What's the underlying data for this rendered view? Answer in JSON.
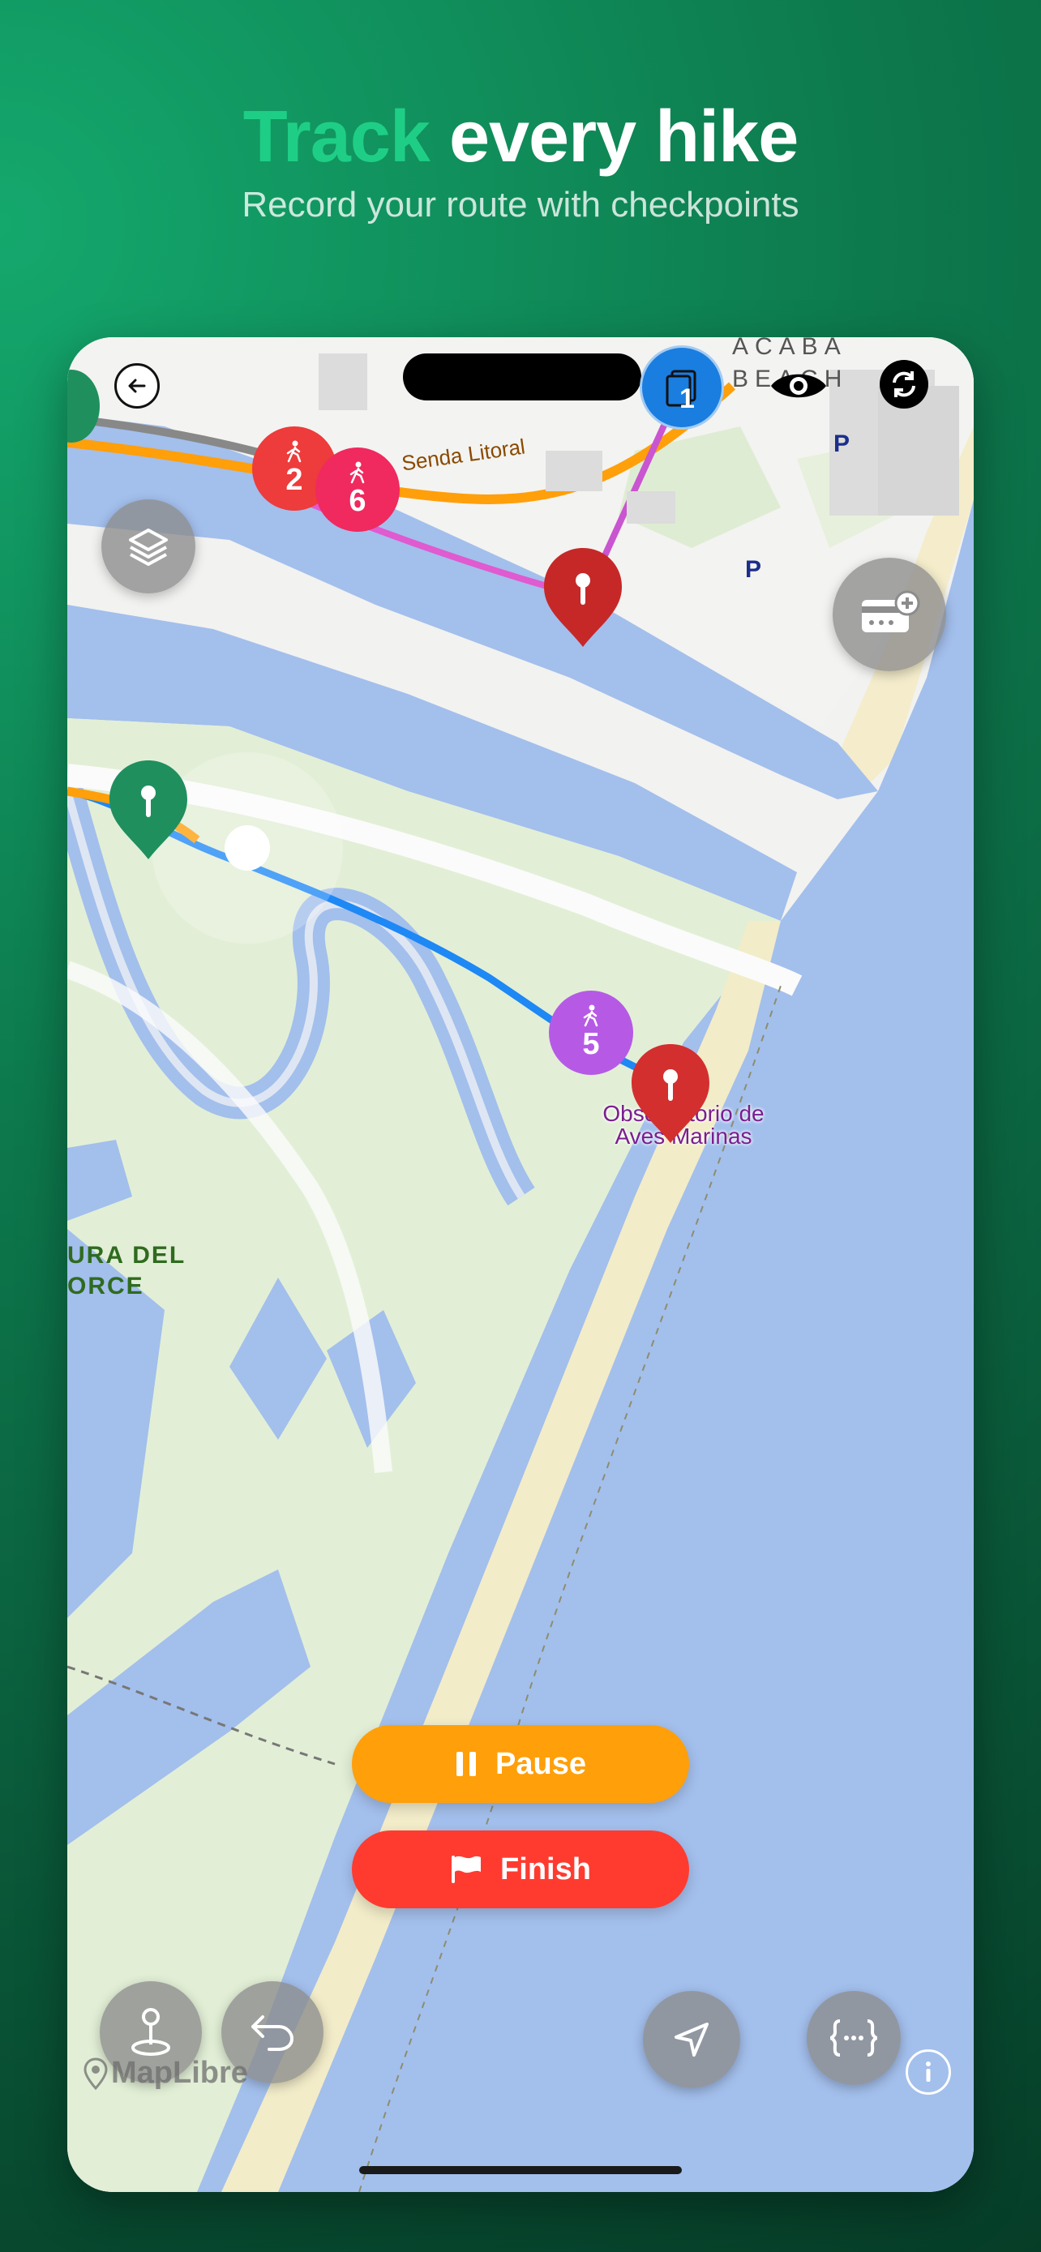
{
  "header": {
    "title_accent": "Track",
    "title_rest": "every hike",
    "subtitle": "Record your route with checkpoints"
  },
  "map": {
    "street_label": "Senda Litoral",
    "beach_label_line1": "ACABA",
    "beach_label_line2": "BEACH",
    "poi_label_line1": "Observatorio de",
    "poi_label_line2": "Aves Marinas",
    "area_label_line1": "URA DEL",
    "area_label_line2": "ORCE",
    "parking_label": "P",
    "attribution": "MapLibre"
  },
  "checkpoints": [
    {
      "number": "2",
      "color": "#ee3b3b"
    },
    {
      "number": "6",
      "color": "#f0295f"
    },
    {
      "number": "5",
      "color": "#b65ae6"
    },
    {
      "number": "1",
      "color": "#1a7de0"
    }
  ],
  "actions": {
    "pause_label": "Pause",
    "finish_label": "Finish"
  },
  "colors": {
    "accent_green": "#1fce86",
    "pause": "#ff9f0a",
    "finish": "#ff3b30",
    "water": "#a3bfec",
    "park": "#e2efd6"
  },
  "icons": [
    "back-arrow-icon",
    "layers-icon",
    "add-card-icon",
    "eye-icon",
    "refresh-icon",
    "pages-icon",
    "pin-location-icon",
    "undo-icon",
    "navigate-arrow-icon",
    "braces-icon",
    "info-icon",
    "pause-icon",
    "flag-icon",
    "walker-icon"
  ]
}
